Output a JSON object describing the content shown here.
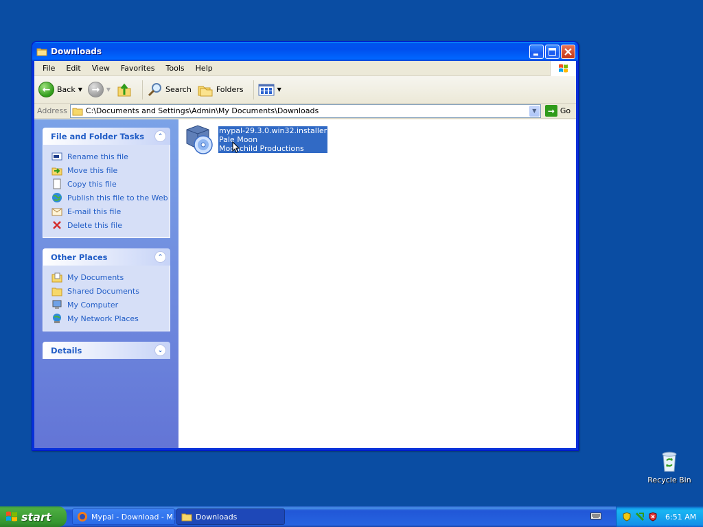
{
  "window": {
    "title": "Downloads",
    "menu": [
      "File",
      "Edit",
      "View",
      "Favorites",
      "Tools",
      "Help"
    ],
    "toolbar": {
      "back": "Back",
      "search": "Search",
      "folders": "Folders"
    },
    "address": {
      "label": "Address",
      "path": "C:\\Documents and Settings\\Admin\\My Documents\\Downloads",
      "go": "Go"
    },
    "file_tasks": {
      "title": "File and Folder Tasks",
      "items": [
        {
          "label": "Rename this file",
          "icon": "rename-icon"
        },
        {
          "label": "Move this file",
          "icon": "move-icon"
        },
        {
          "label": "Copy this file",
          "icon": "copy-icon"
        },
        {
          "label": "Publish this file to the Web",
          "icon": "globe-icon"
        },
        {
          "label": "E-mail this file",
          "icon": "email-icon"
        },
        {
          "label": "Delete this file",
          "icon": "delete-icon"
        }
      ]
    },
    "other_places": {
      "title": "Other Places",
      "items": [
        {
          "label": "My Documents",
          "icon": "my-documents-icon"
        },
        {
          "label": "Shared Documents",
          "icon": "folder-icon"
        },
        {
          "label": "My Computer",
          "icon": "computer-icon"
        },
        {
          "label": "My Network Places",
          "icon": "network-icon"
        }
      ]
    },
    "details": {
      "title": "Details"
    },
    "file": {
      "name": "mypal-29.3.0.win32.installer",
      "line2": "Pale Moon",
      "line3": "Moonchild Productions"
    }
  },
  "desktop": {
    "recycle_bin": "Recycle Bin"
  },
  "taskbar": {
    "start": "start",
    "buttons": [
      {
        "label": "Mypal - Download - M...",
        "icon": "browser-icon"
      },
      {
        "label": "Downloads",
        "icon": "folder-icon"
      }
    ],
    "clock": "6:51 AM"
  },
  "colors": {
    "desktop": "#0a4da3",
    "titlebar": "#0053ee",
    "taskpane_link": "#215dc6",
    "selection": "#316ac5"
  }
}
